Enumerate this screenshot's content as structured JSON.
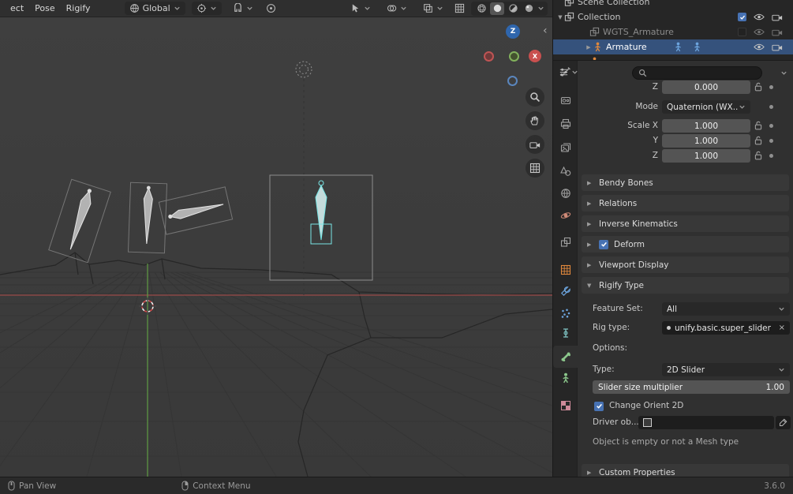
{
  "header": {
    "menus": [
      {
        "label": "ect"
      },
      {
        "label": "Pose"
      },
      {
        "label": "Rigify"
      }
    ],
    "orientation": {
      "label": "Global"
    }
  },
  "viewport": {
    "gizmo": {
      "z": "Z",
      "x": "X"
    },
    "npanel_toggle": "‹"
  },
  "outliner": {
    "rows": [
      {
        "label": "Scene Collection"
      },
      {
        "label": "Collection"
      },
      {
        "label": "WGTS_Armature"
      },
      {
        "label": "Armature"
      }
    ]
  },
  "glyphs": {
    "collapsed": "▶",
    "expanded": "▼",
    "close": "×"
  },
  "properties": {
    "search": {
      "value": "",
      "placeholder": ""
    },
    "transform": {
      "z": {
        "label": "Z",
        "value": "0.000"
      },
      "mode": {
        "label": "Mode",
        "value": "Quaternion (WX..."
      },
      "scale_x": {
        "label": "Scale X",
        "value": "1.000"
      },
      "scale_y": {
        "label": "Y",
        "value": "1.000"
      },
      "scale_z": {
        "label": "Z",
        "value": "1.000"
      }
    },
    "panels": {
      "bendy_bones": "Bendy Bones",
      "relations": "Relations",
      "inverse_kinematics": "Inverse Kinematics",
      "deform": "Deform",
      "viewport_display": "Viewport Display",
      "rigify_type": "Rigify Type",
      "custom_properties": "Custom Properties"
    },
    "rigify": {
      "feature_set_label": "Feature Set:",
      "feature_set_value": "All",
      "rig_type_label": "Rig type:",
      "rig_type_value": "unify.basic.super_slider",
      "options_label": "Options:",
      "type_label": "Type:",
      "type_value": "2D Slider",
      "slider_label": "Slider size multiplier",
      "slider_value": "1.00",
      "change_orient_label": "Change Orient 2D",
      "driver_label": "Driver ob...",
      "info_text": "Object is empty or not a Mesh type"
    }
  },
  "statusbar": {
    "hints": [
      {
        "label": "Pan View"
      },
      {
        "label": "Context Menu"
      }
    ],
    "version": "3.6.0"
  }
}
